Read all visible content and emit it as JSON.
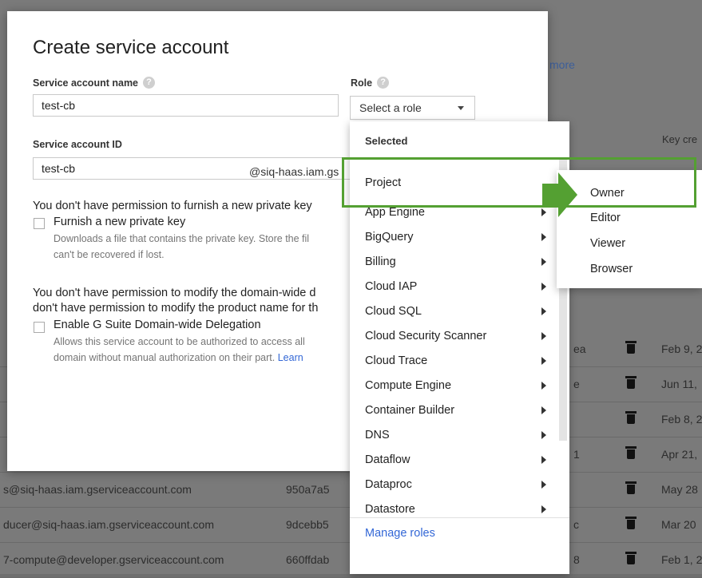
{
  "background": {
    "more_link": "more",
    "key_created_header": "Key cre",
    "rows": [
      {
        "email": "",
        "key_id": "",
        "key_fragment": "ea",
        "date": "Feb 9, 2"
      },
      {
        "email": "",
        "key_id": "",
        "key_fragment": "e",
        "date": "Jun 11,"
      },
      {
        "email": "",
        "key_id": "",
        "key_fragment": "",
        "date": "Feb 8, 2"
      },
      {
        "email": "",
        "key_id": "",
        "key_fragment": "1",
        "date": "Apr 21,"
      },
      {
        "email": "s@siq-haas.iam.gserviceaccount.com",
        "key_id": "950a7a5",
        "key_fragment": "",
        "date": "May 28"
      },
      {
        "email": "ducer@siq-haas.iam.gserviceaccount.com",
        "key_id": "9dcebb5",
        "key_fragment": "c",
        "date": "Mar 20"
      },
      {
        "email": "7-compute@developer.gserviceaccount.com",
        "key_id": "660ffdab",
        "key_fragment": "8",
        "date": "Feb 1, 2"
      }
    ]
  },
  "dialog": {
    "title": "Create service account",
    "service_account_name_label": "Service account name",
    "service_account_name_value": "test-cb",
    "service_account_id_label": "Service account ID",
    "service_account_id_value": "test-cb",
    "service_account_id_suffix": "@siq-haas.iam.gs",
    "role_label": "Role",
    "role_select_value": "Select a role",
    "private_key_permission_text": "You don't have permission to furnish a new private key",
    "furnish_key_label": "Furnish a new private key",
    "furnish_key_desc_1": "Downloads a file that contains the private key. Store the fil",
    "furnish_key_desc_2": "can't be recovered if lost.",
    "domain_permission_text_1": "You don't have permission to modify the domain-wide d",
    "domain_permission_text_2": "don't have permission to modify the product name for th",
    "gsuite_label": "Enable G Suite Domain-wide Delegation",
    "gsuite_desc_1": "Allows this service account to be authorized to access all",
    "gsuite_desc_2": "domain without manual authorization on their part.",
    "gsuite_learn_link": "Learn"
  },
  "role_menu": {
    "header": "Selected",
    "items": [
      "Project",
      "App Engine",
      "BigQuery",
      "Billing",
      "Cloud IAP",
      "Cloud SQL",
      "Cloud Security Scanner",
      "Cloud Trace",
      "Compute Engine",
      "Container Builder",
      "DNS",
      "Dataflow",
      "Dataproc",
      "Datastore"
    ],
    "footer": "Manage roles"
  },
  "project_submenu": {
    "items": [
      "Owner",
      "Editor",
      "Viewer",
      "Browser"
    ]
  },
  "colors": {
    "annotation_green": "#54a032",
    "link_blue": "#3367d6",
    "overlay_gray": "#7a7a7a"
  }
}
